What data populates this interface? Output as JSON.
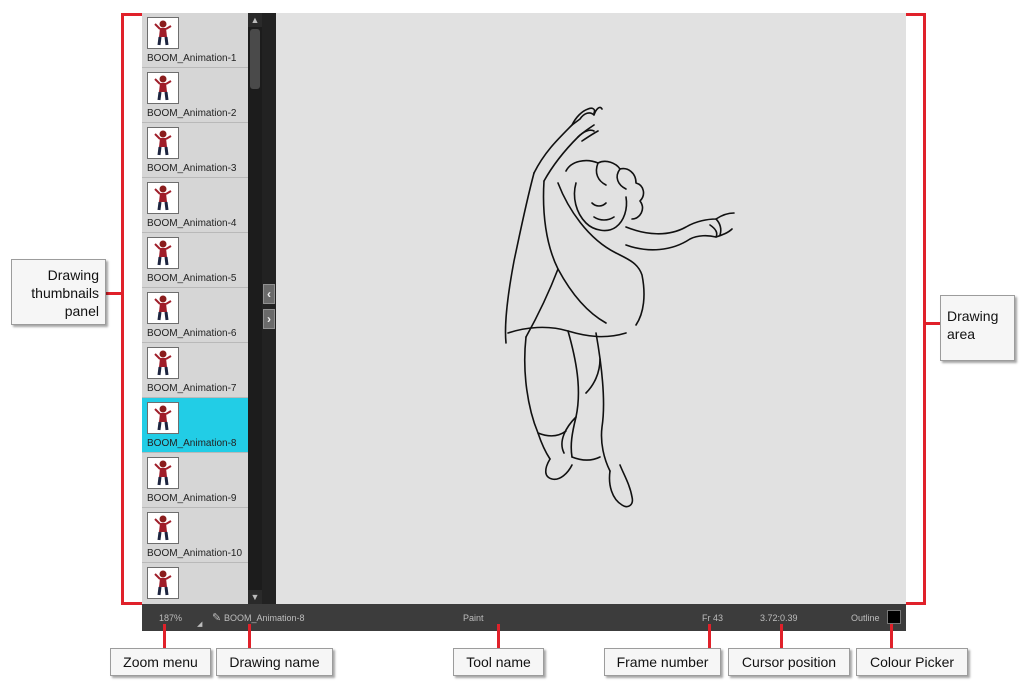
{
  "thumbnails": [
    {
      "label": "BOOM_Animation-1"
    },
    {
      "label": "BOOM_Animation-2"
    },
    {
      "label": "BOOM_Animation-3"
    },
    {
      "label": "BOOM_Animation-4"
    },
    {
      "label": "BOOM_Animation-5"
    },
    {
      "label": "BOOM_Animation-6"
    },
    {
      "label": "BOOM_Animation-7"
    },
    {
      "label": "BOOM_Animation-8",
      "selected": true
    },
    {
      "label": "BOOM_Animation-9"
    },
    {
      "label": "BOOM_Animation-10"
    },
    {
      "label": ""
    }
  ],
  "status": {
    "zoom": "187%",
    "drawing_name": "BOOM_Animation-8",
    "tool": "Paint",
    "frame": "Fr 43",
    "cursor": "3.72:0.39",
    "colour_mode": "Outline",
    "current_colour": "#000000"
  },
  "callouts": {
    "thumbnails_panel": "Drawing thumbnails panel",
    "drawing_area": "Drawing area",
    "zoom_menu": "Zoom menu",
    "drawing_name": "Drawing name",
    "tool_name": "Tool name",
    "frame_number": "Frame number",
    "cursor_position": "Cursor position",
    "colour_picker": "Colour Picker"
  },
  "colors": {
    "selection": "#22cde6",
    "callout_lines": "#e0212a"
  },
  "icons": {
    "scroll_up": "triangle-up-icon",
    "scroll_down": "triangle-down-icon",
    "collapse": "chevron-left-icon",
    "expand": "chevron-right-icon",
    "drawing": "brush-icon"
  }
}
